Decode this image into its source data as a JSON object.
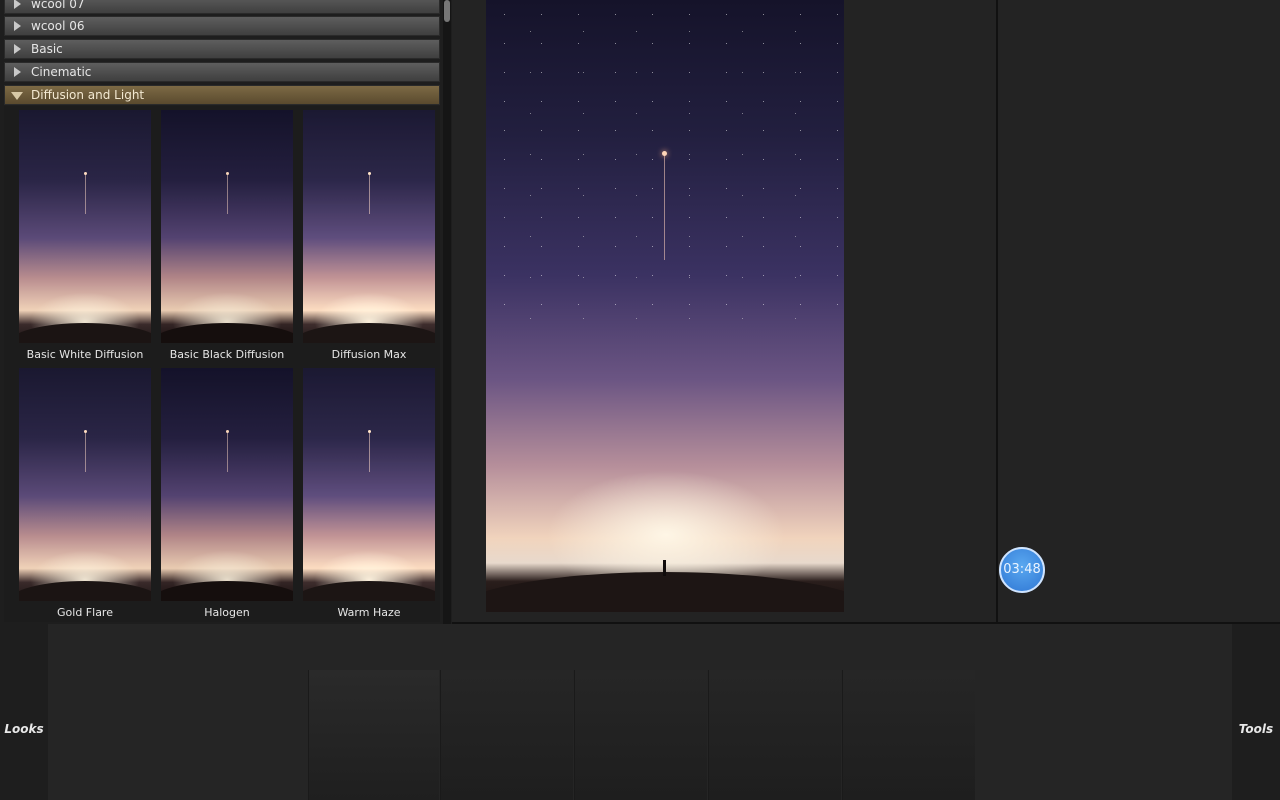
{
  "panel": {
    "categories": [
      {
        "label": "wcool 07",
        "state": "collapsed"
      },
      {
        "label": "wcool 06",
        "state": "collapsed"
      },
      {
        "label": "Basic",
        "state": "collapsed"
      },
      {
        "label": "Cinematic",
        "state": "collapsed"
      },
      {
        "label": "Diffusion and Light",
        "state": "expanded"
      }
    ],
    "looks": [
      {
        "label": "Basic White Diffusion"
      },
      {
        "label": "Basic Black Diffusion"
      },
      {
        "label": "Diffusion Max"
      },
      {
        "label": "Gold Flare"
      },
      {
        "label": "Halogen"
      },
      {
        "label": "Warm Haze"
      }
    ]
  },
  "timer": {
    "label": "03:48"
  },
  "bottom": {
    "looks_tab": "Looks",
    "tools_tab": "Tools"
  },
  "colors": {
    "accent_open_category": "#7d6a45",
    "timer": "#3a86e0"
  }
}
